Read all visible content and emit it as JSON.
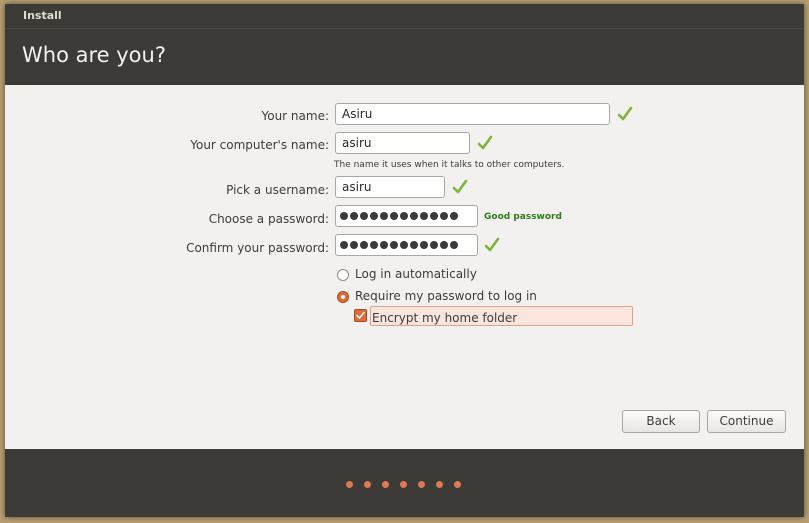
{
  "window": {
    "title": "Install",
    "heading": "Who are you?"
  },
  "form": {
    "your_name": {
      "label": "Your name:",
      "value": "Asiru",
      "valid": true
    },
    "computer_name": {
      "label": "Your computer's name:",
      "value": "asiru",
      "valid": true,
      "hint": "The name it uses when it talks to other computers."
    },
    "username": {
      "label": "Pick a username:",
      "value": "asiru",
      "valid": true
    },
    "password": {
      "label": "Choose a password:",
      "masked_length": 12,
      "strength": "Good password"
    },
    "confirm_password": {
      "label": "Confirm your password:",
      "masked_length": 12,
      "valid": true
    },
    "login_options": [
      {
        "label": "Log in automatically",
        "selected": false
      },
      {
        "label": "Require my password to log in",
        "selected": true
      }
    ],
    "encrypt_home": {
      "label": "Encrypt my home folder",
      "checked": true
    }
  },
  "buttons": {
    "back": "Back",
    "continue": "Continue"
  },
  "progress": {
    "total_steps": 7
  },
  "colors": {
    "dark_chrome": "#3c3b37",
    "accent": "#e06b3a",
    "valid_check": "#7fb33a",
    "good_password": "#2e7d1a"
  },
  "icons": {
    "valid": "check-mark-icon"
  }
}
